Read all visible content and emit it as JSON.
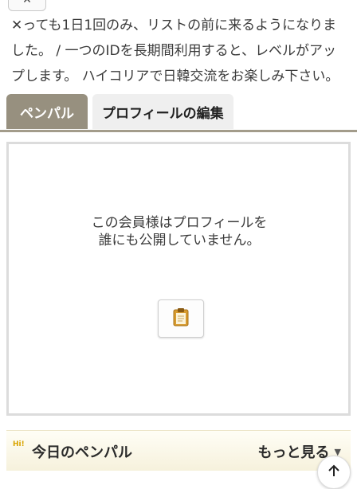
{
  "intro_text": "✕っても1日1回のみ、リストの前に来るようになりました。 / 一つのIDを長期間利用すると、レベルがアップします。 ハイコリアで日韓交流をお楽しみ下さい。",
  "tabs": [
    {
      "label": "ペンパル",
      "active": true
    },
    {
      "label": "プロフィールの編集",
      "active": false
    }
  ],
  "panel": {
    "message": "この会員様はプロフィールを誰にも公開していません。",
    "button_icon": "clipboard-icon"
  },
  "bottom_bar": {
    "badge": "Hi!",
    "title": "今日のペンパル",
    "more_label": "もっと見る"
  },
  "colors": {
    "tab_active": "#97907f",
    "tab_inactive": "#efefef",
    "accent_line": "#a39c8b"
  },
  "icons": {
    "close": "close-icon",
    "clipboard": "clipboard-icon",
    "more_caret": "caret-down-icon",
    "scroll_top": "arrow-up-icon"
  }
}
